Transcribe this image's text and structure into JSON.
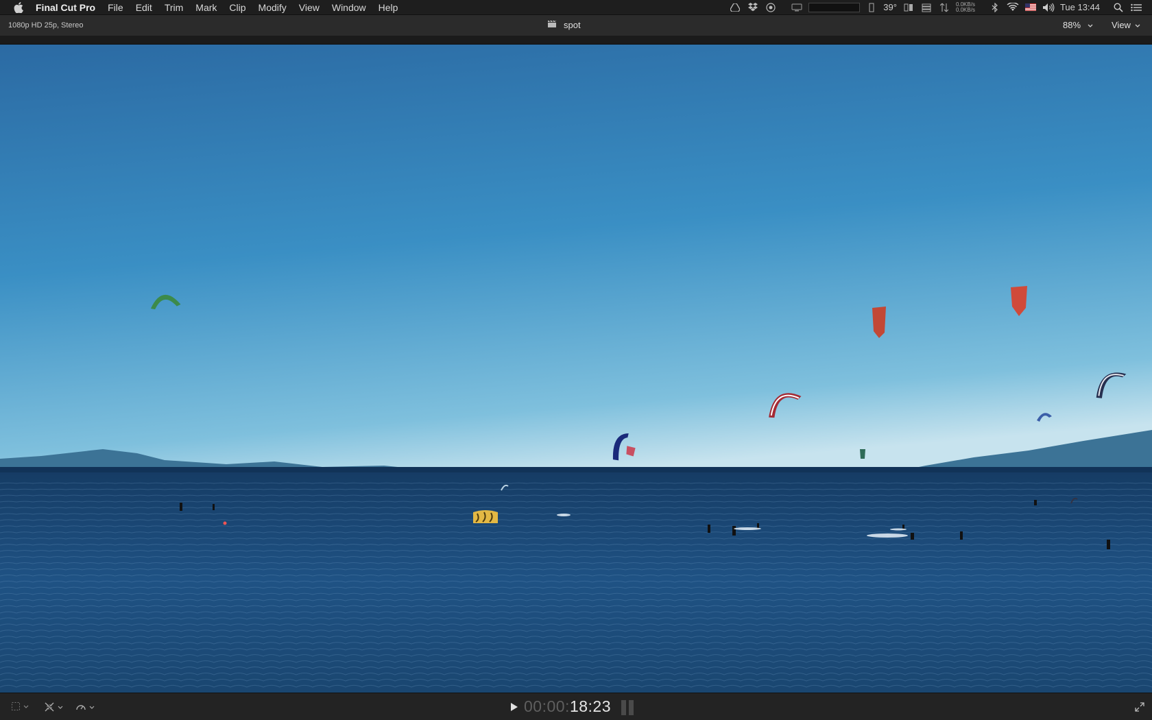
{
  "menubar": {
    "app_name": "Final Cut Pro",
    "menus": [
      "File",
      "Edit",
      "Trim",
      "Mark",
      "Clip",
      "Modify",
      "View",
      "Window",
      "Help"
    ],
    "temperature": "39°",
    "net_up": "0.0KB/s",
    "net_down": "0.0KB/s",
    "clock": "Tue 13:44",
    "status_icons": [
      "google-drive-icon",
      "dropbox-icon",
      "activity-icon",
      "display-icon",
      "cpu-meter",
      "sensor-icon",
      "memory-icon",
      "disk-icon",
      "network-icon",
      "bluetooth-icon",
      "wifi-icon",
      "us-flag-icon",
      "volume-icon",
      "spotlight-icon",
      "notification-center-icon"
    ]
  },
  "viewer": {
    "format": "1080p HD 25p, Stereo",
    "project_name": "spot",
    "zoom": "88%",
    "view_label": "View"
  },
  "playback": {
    "timecode_dim": "00:00:",
    "timecode": "18:23"
  },
  "colors": {
    "sky_top": "#2c6ea6",
    "sky_bottom": "#cfe6ef",
    "sea": "#1c4f7c",
    "mountains": "#3e7394"
  }
}
